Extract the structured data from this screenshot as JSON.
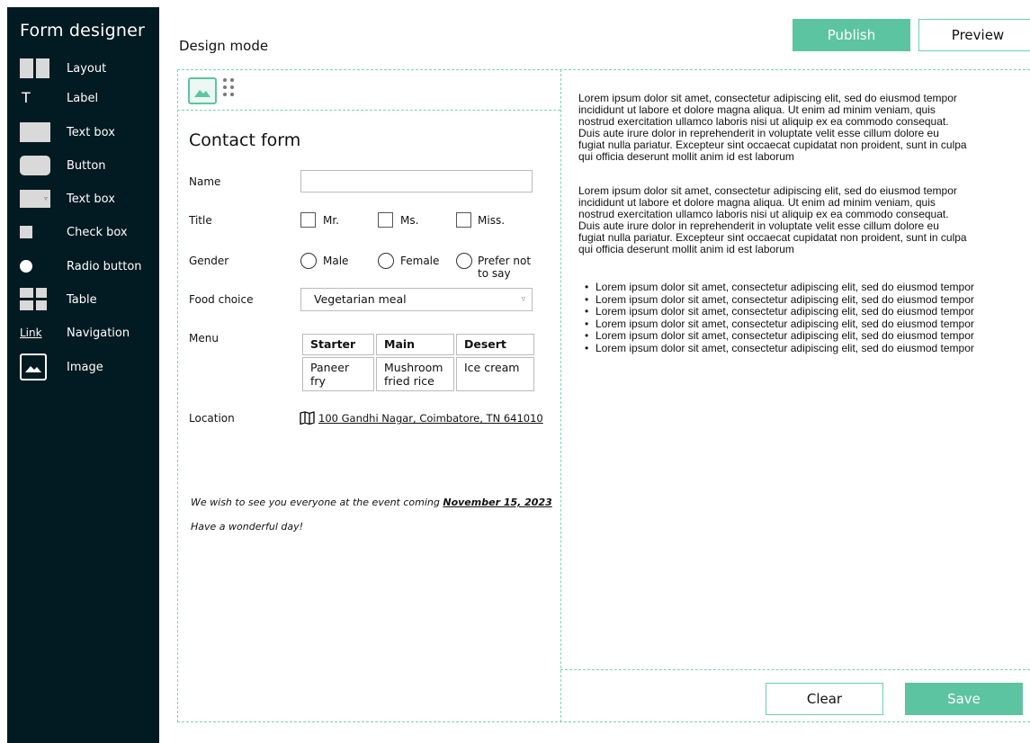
{
  "sidebar": {
    "title": "Form designer",
    "items": [
      {
        "label": "Layout",
        "icon": "layout-icon"
      },
      {
        "label": "Label",
        "icon": "label-icon",
        "glyph": "T"
      },
      {
        "label": "Text box",
        "icon": "text-box-icon"
      },
      {
        "label": "Button",
        "icon": "button-icon"
      },
      {
        "label": "Text box",
        "icon": "dropdown-icon",
        "glyph": "▿"
      },
      {
        "label": "Check box",
        "icon": "checkbox-icon"
      },
      {
        "label": "Radio button",
        "icon": "radio-icon"
      },
      {
        "label": "Table",
        "icon": "table-icon"
      },
      {
        "label": "Navigation",
        "icon": "link-icon",
        "glyph": "Link"
      },
      {
        "label": "Image",
        "icon": "image-icon"
      }
    ]
  },
  "header": {
    "mode_title": "Design mode",
    "publish_label": "Publish",
    "preview_label": "Preview"
  },
  "form": {
    "title": "Contact form",
    "name_label": "Name",
    "name_value": "",
    "title_label": "Title",
    "title_options": [
      "Mr.",
      "Ms.",
      "Miss."
    ],
    "gender_label": "Gender",
    "gender_options": [
      "Male",
      "Female",
      "Prefer not",
      "to say"
    ],
    "food_label": "Food choice",
    "food_value": "Vegetarian meal",
    "food_arrow": "▿",
    "menu_label": "Menu",
    "menu_headers": [
      "Starter",
      "Main",
      "Desert"
    ],
    "menu_cells": [
      "Paneer fry",
      "Mushroom",
      "fried rice",
      "Ice cream"
    ],
    "location_label": "Location",
    "location_value": "100 Gandhi Nagar, Coimbatore, TN 641010",
    "note_text": "We wish to see you everyone at the event coming ",
    "note_date": "November 15, 2023",
    "note_2": "Have a wonderful day!"
  },
  "panel": {
    "paragraph_1": [
      "Lorem ipsum dolor sit amet, consectetur adipiscing elit, sed do eiusmod tempor",
      "incididunt ut labore et dolore magna aliqua. Ut enim ad minim veniam, quis",
      "nostrud exercitation ullamco laboris nisi ut aliquip ex ea commodo consequat.",
      "Duis aute irure dolor in reprehenderit in voluptate velit esse cillum dolore eu",
      "fugiat nulla pariatur. Excepteur sint occaecat cupidatat non proident, sunt in culpa",
      "qui officia deserunt mollit anim id est laborum"
    ],
    "paragraph_2": [
      "Lorem ipsum dolor sit amet, consectetur adipiscing elit, sed do eiusmod tempor",
      "incididunt ut labore et dolore magna aliqua. Ut enim ad minim veniam, quis",
      "nostrud exercitation ullamco laboris nisi ut aliquip ex ea commodo consequat.",
      "Duis aute irure dolor in reprehenderit in voluptate velit esse cillum dolore eu",
      "fugiat nulla pariatur. Excepteur sint occaecat cupidatat non proident, sunt in culpa",
      "qui officia deserunt mollit anim id est laborum"
    ],
    "bullets": [
      "Lorem ipsum dolor sit amet, consectetur adipiscing elit, sed do eiusmod tempor",
      "Lorem ipsum dolor sit amet, consectetur adipiscing elit, sed do eiusmod tempor",
      "Lorem ipsum dolor sit amet, consectetur adipiscing elit, sed do eiusmod tempor",
      "Lorem ipsum dolor sit amet, consectetur adipiscing elit, sed do eiusmod tempor",
      "Lorem ipsum dolor sit amet, consectetur adipiscing elit, sed do eiusmod tempor",
      "Lorem ipsum dolor sit amet, consectetur adipiscing elit, sed do eiusmod tempor"
    ],
    "clear_label": "Clear",
    "save_label": "Save"
  },
  "colors": {
    "sidebar_bg": "#021a21",
    "accent": "#5dc4a2",
    "dash": "#7fd0b8"
  }
}
